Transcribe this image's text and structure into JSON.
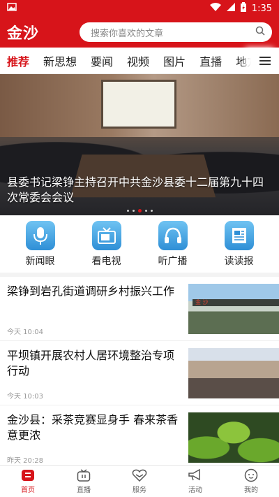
{
  "status_bar": {
    "time": "1:35"
  },
  "header": {
    "logo": "金沙",
    "search_placeholder": "搜索你喜欢的文章"
  },
  "tabs": [
    "推荐",
    "新思想",
    "要闻",
    "视频",
    "图片",
    "直播",
    "地方"
  ],
  "banner": {
    "caption": "县委书记梁铮主持召开中共金沙县委十二届第九十四次常委会会议",
    "thumb_sign": "金 沙"
  },
  "quick_links": [
    {
      "label": "新闻眼",
      "icon": "microphone-icon"
    },
    {
      "label": "看电视",
      "icon": "tv-icon"
    },
    {
      "label": "听广播",
      "icon": "headphones-icon"
    },
    {
      "label": "读读报",
      "icon": "newspaper-icon"
    }
  ],
  "news": [
    {
      "title": "梁铮到岩孔街道调研乡村振兴工作",
      "time": "今天 10:04"
    },
    {
      "title": "平坝镇开展农村人居环境整治专项行动",
      "time": "今天 10:03"
    },
    {
      "title": "金沙县：采茶竞赛显身手 春来茶香意更浓",
      "time": "昨天 20:28"
    }
  ],
  "bottom_nav": [
    {
      "label": "首页",
      "icon": "home-icon",
      "active": true
    },
    {
      "label": "直播",
      "icon": "live-tv-icon"
    },
    {
      "label": "服务",
      "icon": "service-heart-icon"
    },
    {
      "label": "活动",
      "icon": "megaphone-icon"
    },
    {
      "label": "我的",
      "icon": "profile-icon"
    }
  ],
  "colors": {
    "brand": "#d7141a"
  }
}
